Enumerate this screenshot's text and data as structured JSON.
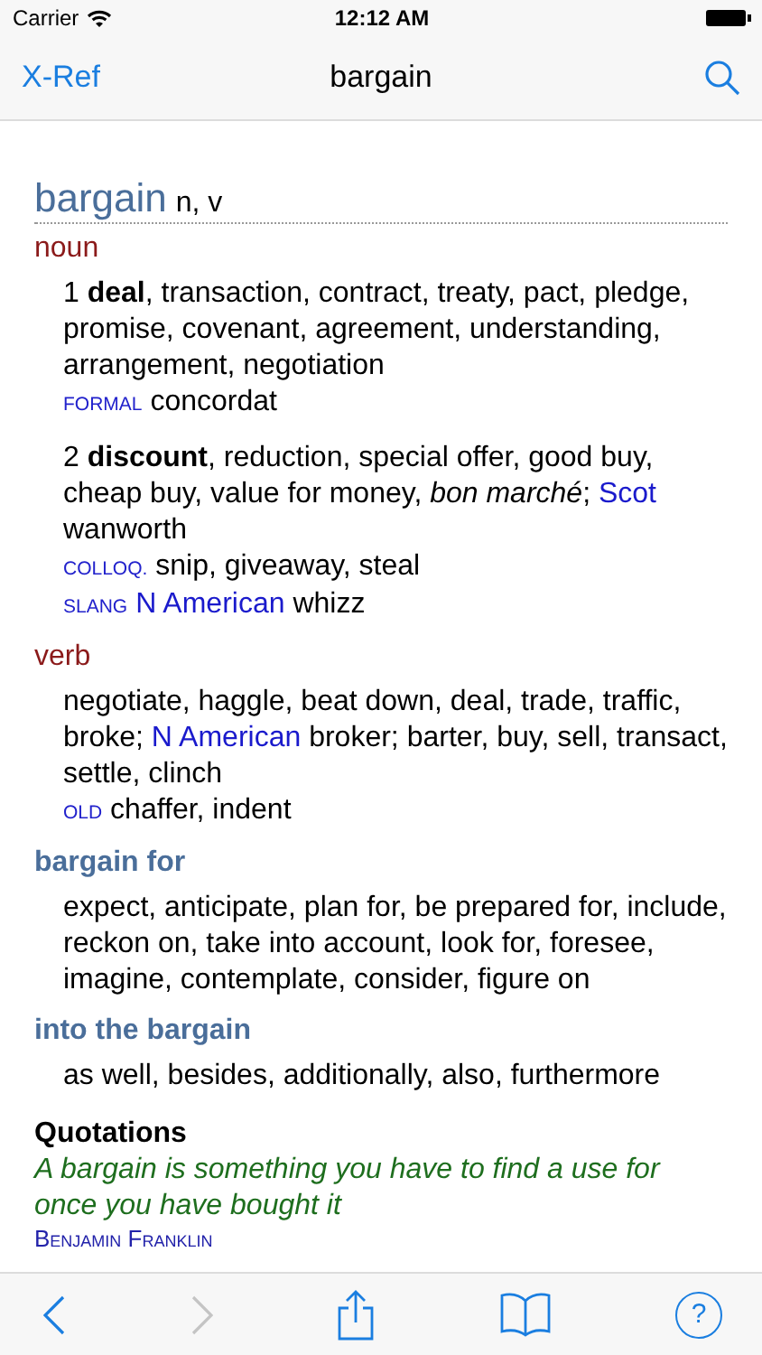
{
  "status_bar": {
    "carrier": "Carrier",
    "time": "12:12 AM"
  },
  "nav_bar": {
    "back": "X-Ref",
    "title": "bargain"
  },
  "entry": {
    "headword": "bargain",
    "pos": "n, v"
  },
  "sections": [
    {
      "kind": "pos",
      "heading": "noun",
      "senses": [
        {
          "lines": [
            [
              {
                "kind": "text",
                "text": "1 **deal**, transaction, contract, treaty, pact, pledge, promise, covenant, agreement, understanding, arrangement, negotiation"
              }
            ],
            [
              {
                "kind": "register",
                "text": "FORMAL"
              },
              {
                "kind": "text",
                "text": "concordat"
              }
            ]
          ]
        },
        {
          "lines": [
            [
              {
                "kind": "text",
                "text": "2 **discount**, reduction, special offer, good buy, cheap buy, value for money, *bon marché*;"
              },
              {
                "kind": "link",
                "text": "Scot"
              },
              {
                "kind": "text",
                "text": "wanworth"
              }
            ],
            [
              {
                "kind": "register",
                "text": "COLLOQ."
              },
              {
                "kind": "text",
                "text": "snip, giveaway, steal"
              }
            ],
            [
              {
                "kind": "register",
                "text": "SLANG"
              },
              {
                "kind": "link",
                "text": "N American"
              },
              {
                "kind": "text",
                "text": "whizz"
              }
            ]
          ]
        }
      ]
    },
    {
      "kind": "pos",
      "heading": "verb",
      "senses": [
        {
          "lines": [
            [
              {
                "kind": "text",
                "text": "negotiate, haggle, beat down, deal, trade, traffic, broke;"
              },
              {
                "kind": "link",
                "text": "N American"
              },
              {
                "kind": "text",
                "text": "broker; barter, buy, sell, transact, settle, clinch"
              }
            ],
            [
              {
                "kind": "register",
                "text": "OLD"
              },
              {
                "kind": "text",
                "text": "chaffer, indent"
              }
            ]
          ]
        }
      ]
    },
    {
      "kind": "phrase",
      "heading": "bargain for",
      "senses": [
        {
          "lines": [
            [
              {
                "kind": "text",
                "text": "expect, anticipate, plan for, be prepared for, include, reckon on, take into account, look for, foresee, imagine, contemplate, consider, figure on"
              }
            ]
          ]
        }
      ]
    },
    {
      "kind": "phrase",
      "heading": "into the bargain",
      "senses": [
        {
          "lines": [
            [
              {
                "kind": "text",
                "text": "as well, besides, additionally, also, furthermore"
              }
            ]
          ]
        }
      ]
    }
  ],
  "quotations": {
    "heading": "Quotations",
    "items": [
      {
        "text": "A bargain is something you have to find a use for once you have bought it",
        "author": "Benjamin Franklin"
      }
    ]
  },
  "toolbar": [
    {
      "kind": "back",
      "disabled": false
    },
    {
      "kind": "forward",
      "disabled": true
    },
    {
      "kind": "share",
      "disabled": false
    },
    {
      "kind": "book",
      "disabled": false
    },
    {
      "kind": "help",
      "disabled": false,
      "label": "?"
    }
  ]
}
